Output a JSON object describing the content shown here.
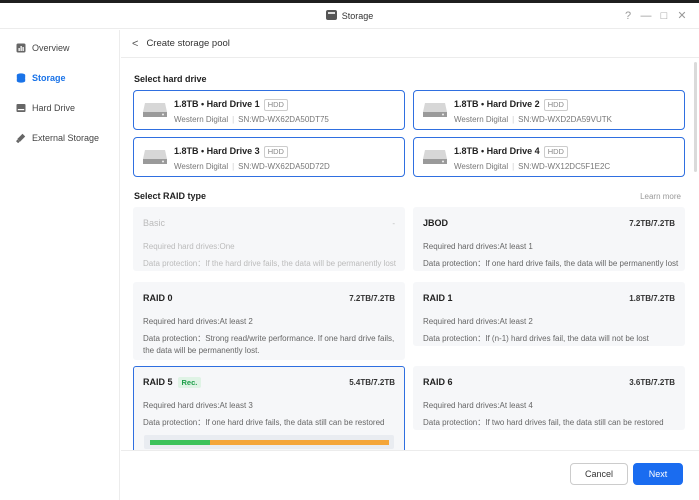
{
  "window": {
    "title": "Storage",
    "help": "?",
    "minimize": "—",
    "maximize": "□",
    "close": "✕"
  },
  "sidebar": {
    "items": [
      {
        "label": "Overview",
        "icon": "overview-icon",
        "active": false
      },
      {
        "label": "Storage",
        "icon": "storage-icon",
        "active": true
      },
      {
        "label": "Hard Drive",
        "icon": "hard-drive-icon",
        "active": false
      },
      {
        "label": "External Storage",
        "icon": "external-storage-icon",
        "active": false
      }
    ]
  },
  "header": {
    "back": "<",
    "title": "Create storage pool"
  },
  "select_drive": {
    "title": "Select hard drive"
  },
  "drives": [
    {
      "name": "1.8TB • Hard Drive 1",
      "tag": "HDD",
      "vendor": "Western Digital",
      "serial": "SN:WD-WX62DA50DT75"
    },
    {
      "name": "1.8TB • Hard Drive 2",
      "tag": "HDD",
      "vendor": "Western Digital",
      "serial": "SN:WD-WXD2DA59VUTK"
    },
    {
      "name": "1.8TB • Hard Drive 3",
      "tag": "HDD",
      "vendor": "Western Digital",
      "serial": "SN:WD-WX62DA50D72D"
    },
    {
      "name": "1.8TB • Hard Drive 4",
      "tag": "HDD",
      "vendor": "Western Digital",
      "serial": "SN:WD-WX12DC5F1E2C"
    }
  ],
  "select_raid": {
    "title": "Select RAID type",
    "learn_more": "Learn more"
  },
  "raid_types": [
    {
      "name": "Basic",
      "capacity": "-",
      "required": "Required hard drives:One",
      "protection": "Data protection：If the hard drive fails, the data will be permanently lost",
      "disabled": true,
      "rec": ""
    },
    {
      "name": "JBOD",
      "capacity": "7.2TB/7.2TB",
      "required": "Required hard drives:At least 1",
      "protection": "Data protection：If one hard drive fails, the data will be permanently lost",
      "disabled": false,
      "rec": ""
    },
    {
      "name": "RAID 0",
      "capacity": "7.2TB/7.2TB",
      "required": "Required hard drives:At least 2",
      "protection": "Data protection：Strong read/write performance. If one hard drive fails, the data will be permanently lost.",
      "disabled": false,
      "rec": ""
    },
    {
      "name": "RAID 1",
      "capacity": "1.8TB/7.2TB",
      "required": "Required hard drives:At least 2",
      "protection": "Data protection：If (n-1) hard drives fail, the data will not be lost",
      "disabled": false,
      "rec": ""
    },
    {
      "name": "RAID 5",
      "capacity": "5.4TB/7.2TB",
      "required": "Required hard drives:At least 3",
      "protection": "Data protection：If one hard drive fails, the data still can be restored",
      "disabled": false,
      "rec": "Rec."
    },
    {
      "name": "RAID 6",
      "capacity": "3.6TB/7.2TB",
      "required": "Required hard drives:At least 4",
      "protection": "Data protection：If two hard drives fail, the data still can be restored",
      "disabled": false,
      "rec": ""
    }
  ],
  "capacity_bar": {
    "usable_fraction": 0.25,
    "parity_fraction": 0.75
  },
  "colors": {
    "accent": "#1a6cf0",
    "green": "#3cc25b",
    "orange": "#f4a63a"
  },
  "footer": {
    "cancel": "Cancel",
    "next": "Next"
  }
}
